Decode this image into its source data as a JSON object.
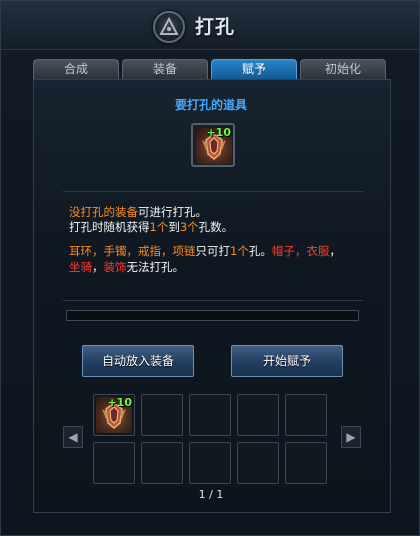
{
  "window": {
    "title": "打孔",
    "emblem_icon": "emblem-icon"
  },
  "tabs": [
    {
      "label": "合成",
      "active": false
    },
    {
      "label": "装备",
      "active": false
    },
    {
      "label": "赋予",
      "active": true
    },
    {
      "label": "初始化",
      "active": false
    }
  ],
  "item_section": {
    "title": "要打孔的道具",
    "slot": {
      "icon": "item-emblem-icon",
      "enhance": "+10"
    }
  },
  "description": {
    "line1": {
      "a": "没打孔的装备",
      "b": "可进行打孔。"
    },
    "line2": {
      "a": "打孔时随机获得",
      "b": "1个",
      "c": "到",
      "d": "3个",
      "e": "孔数。"
    },
    "line3": {
      "a": "耳环，手镯，戒指，项链",
      "b": "只可打",
      "c": "1个",
      "d": "孔。",
      "e": "帽子，衣服",
      "f": "，"
    },
    "line4": {
      "a": "坐骑",
      "b": "，",
      "c": "装饰",
      "d": "无法打孔。"
    }
  },
  "progress": {
    "percent": 0
  },
  "buttons": {
    "auto_equip": "自动放入装备",
    "start": "开始赋予"
  },
  "inventory": {
    "slots": [
      {
        "filled": true,
        "enhance": "+10",
        "icon": "item-emblem-icon"
      },
      {
        "filled": false
      },
      {
        "filled": false
      },
      {
        "filled": false
      },
      {
        "filled": false
      },
      {
        "filled": false
      },
      {
        "filled": false
      },
      {
        "filled": false
      },
      {
        "filled": false
      },
      {
        "filled": false
      }
    ],
    "pager": {
      "current": "1",
      "separator": "/",
      "total": "1"
    }
  },
  "colors": {
    "accent": "#2a84c8",
    "title_blue": "#45a8ff",
    "highlight_orange": "#ff8a1e",
    "highlight_red": "#ff3b2f",
    "enhance_green": "#66ff44"
  }
}
